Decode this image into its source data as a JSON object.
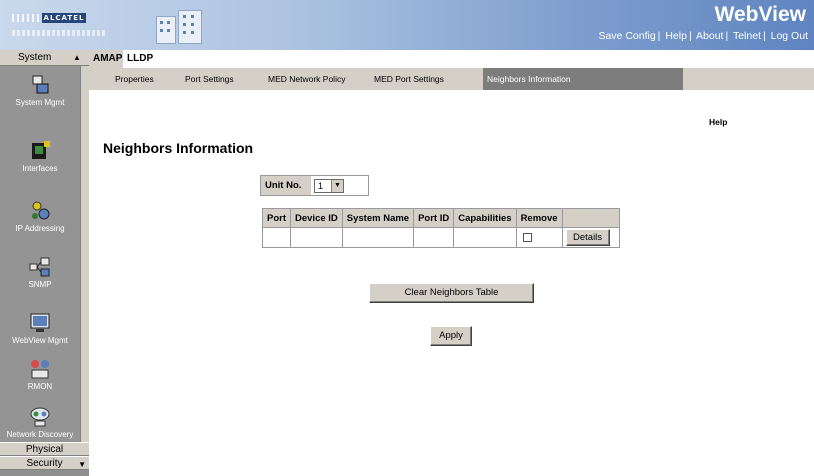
{
  "header": {
    "brand_logo_text": "ALCATEL",
    "app_title": "WebView",
    "links": [
      "Save Config",
      "Help",
      "About",
      "Telnet",
      "Log Out"
    ]
  },
  "sidebar": {
    "title": "System",
    "items": [
      {
        "label": "System Mgmt",
        "icon": "system-mgmt-icon"
      },
      {
        "label": "Interfaces",
        "icon": "interfaces-icon"
      },
      {
        "label": "IP Addressing",
        "icon": "ip-addressing-icon"
      },
      {
        "label": "SNMP",
        "icon": "snmp-icon"
      },
      {
        "label": "WebView Mgmt",
        "icon": "webview-mgmt-icon"
      },
      {
        "label": "RMON",
        "icon": "rmon-icon"
      },
      {
        "label": "Network Discovery",
        "icon": "network-discovery-icon"
      }
    ],
    "bottom_tabs": [
      "Physical",
      "Security"
    ]
  },
  "tabs": {
    "main": [
      "AMAP",
      "LLDP"
    ],
    "sub": [
      "Properties",
      "Port Settings",
      "MED Network Policy",
      "MED Port Settings",
      "Neighbors Information"
    ],
    "active_sub": "Neighbors Information"
  },
  "content": {
    "help_label": "Help",
    "title": "Neighbors Information",
    "unit_label": "Unit No.",
    "unit_value": "1",
    "table": {
      "headers": [
        "Port",
        "Device ID",
        "System Name",
        "Port ID",
        "Capabilities",
        "Remove"
      ],
      "details_button": "Details"
    },
    "clear_button": "Clear Neighbors Table",
    "apply_button": "Apply"
  }
}
